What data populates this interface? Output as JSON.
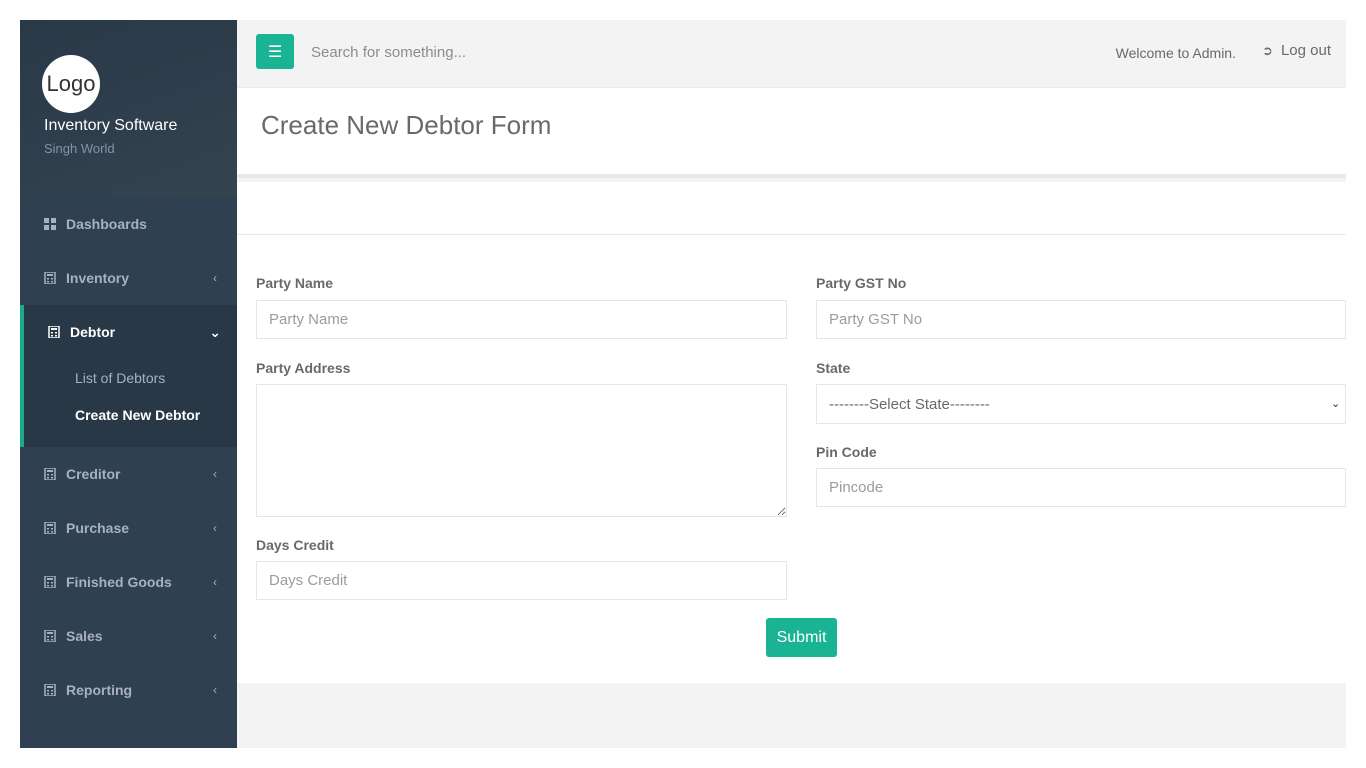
{
  "app": {
    "logo_text": "Logo",
    "name": "Inventory Software",
    "subtitle": "Singh World"
  },
  "sidebar": {
    "items": [
      {
        "label": "Dashboards",
        "icon": "th-large-icon"
      },
      {
        "label": "Inventory",
        "icon": "calculator-icon"
      },
      {
        "label": "Debtor",
        "icon": "calculator-icon"
      },
      {
        "label": "Creditor",
        "icon": "calculator-icon"
      },
      {
        "label": "Purchase",
        "icon": "calculator-icon"
      },
      {
        "label": "Finished Goods",
        "icon": "calculator-icon"
      },
      {
        "label": "Sales",
        "icon": "calculator-icon"
      },
      {
        "label": "Reporting",
        "icon": "calculator-icon"
      }
    ],
    "debtor_sub": [
      "List of Debtors",
      "Create New Debtor"
    ]
  },
  "topbar": {
    "search_placeholder": "Search for something...",
    "welcome": "Welcome to Admin.",
    "logout": "Log out"
  },
  "page": {
    "title": "Create New Debtor Form"
  },
  "form": {
    "party_name_label": "Party Name",
    "party_name_placeholder": "Party Name",
    "party_gst_label": "Party GST No",
    "party_gst_placeholder": "Party GST No",
    "party_address_label": "Party Address",
    "state_label": "State",
    "state_selected": "--------Select State--------",
    "pin_label": "Pin Code",
    "pin_placeholder": "Pincode",
    "days_credit_label": "Days Credit",
    "days_credit_placeholder": "Days Credit",
    "submit_label": "Submit"
  },
  "colors": {
    "sidebar": "#2f4050",
    "accent": "#1ab394"
  }
}
